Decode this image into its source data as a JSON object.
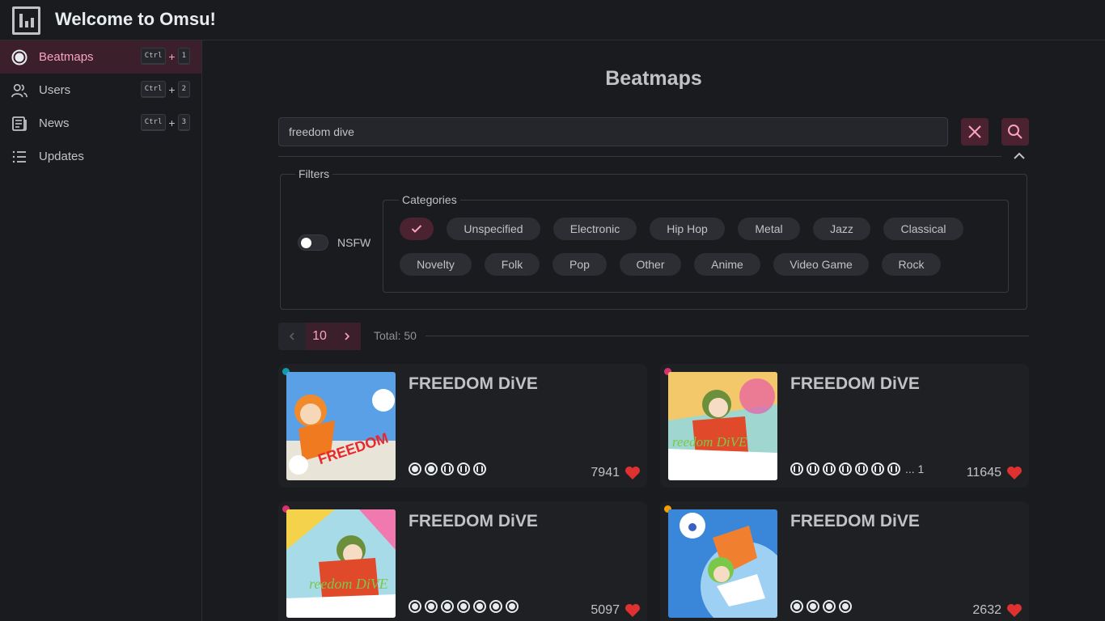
{
  "header": {
    "title": "Welcome to Omsu!",
    "logo_icon": "bar-chart-logo-icon"
  },
  "sidebar": {
    "items": [
      {
        "label": "Beatmaps",
        "icon": "circle-icon",
        "shortcut_key": "Ctrl",
        "shortcut_num": "1",
        "active": true
      },
      {
        "label": "Users",
        "icon": "users-icon",
        "shortcut_key": "Ctrl",
        "shortcut_num": "2",
        "active": false
      },
      {
        "label": "News",
        "icon": "news-icon",
        "shortcut_key": "Ctrl",
        "shortcut_num": "3",
        "active": false
      },
      {
        "label": "Updates",
        "icon": "list-icon",
        "active": false
      }
    ],
    "plus": "+"
  },
  "main": {
    "title": "Beatmaps",
    "search": {
      "value": "freedom dive",
      "placeholder": ""
    },
    "filters": {
      "legend": "Filters",
      "nsfw_label": "NSFW",
      "nsfw_on": false,
      "categories_legend": "Categories",
      "categories": [
        "Unspecified",
        "Electronic",
        "Hip Hop",
        "Metal",
        "Jazz",
        "Classical",
        "Novelty",
        "Folk",
        "Pop",
        "Other",
        "Anime",
        "Video Game",
        "Rock"
      ]
    },
    "pagination": {
      "page": "10",
      "total": "Total: 50"
    },
    "beatmaps": [
      {
        "title": "FREEDOM DiVE",
        "favorites": "7941",
        "status_color": "#1098ad",
        "diff_count": 5,
        "more": ""
      },
      {
        "title": "FREEDOM DiVE",
        "favorites": "11645",
        "status_color": "#d6336c",
        "diff_count": 7,
        "more": "... 1"
      },
      {
        "title": "FREEDOM DiVE",
        "favorites": "5097",
        "status_color": "#d6336c",
        "diff_count": 7,
        "more": ""
      },
      {
        "title": "FREEDOM DiVE",
        "favorites": "2632",
        "status_color": "#f59f00",
        "diff_count": 4,
        "more": ""
      }
    ]
  },
  "colors": {
    "accent": "#faa2c1",
    "accent_bg": "#3b1f2b",
    "heart": "#e03131"
  }
}
